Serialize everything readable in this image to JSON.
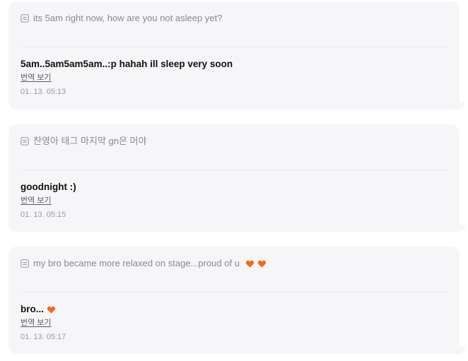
{
  "colors": {
    "card_background": "#f6f6f8",
    "heart": "#f26a1b"
  },
  "messages": [
    {
      "quote": "its 5am right now, how are you not asleep yet?",
      "quote_icon": "message-square-icon",
      "reply": "5am..5am5am5am..:p hahah ill sleep very soon",
      "translate_label": "번역 보기",
      "timestamp": "01. 13. 05:13"
    },
    {
      "quote": "찬영아 태그 마지막 gn은 머야",
      "quote_icon": "message-square-icon",
      "reply": "goodnight :)",
      "translate_label": "번역 보기",
      "timestamp": "01. 13. 05:15"
    },
    {
      "quote": "my bro became more relaxed on stage...proud of u",
      "quote_icon": "message-square-icon",
      "quote_emojis": [
        "orange-heart-icon",
        "orange-heart-icon"
      ],
      "reply": "bro...",
      "reply_emojis": [
        "orange-heart-icon"
      ],
      "translate_label": "번역 보기",
      "timestamp": "01. 13. 05:17"
    }
  ]
}
